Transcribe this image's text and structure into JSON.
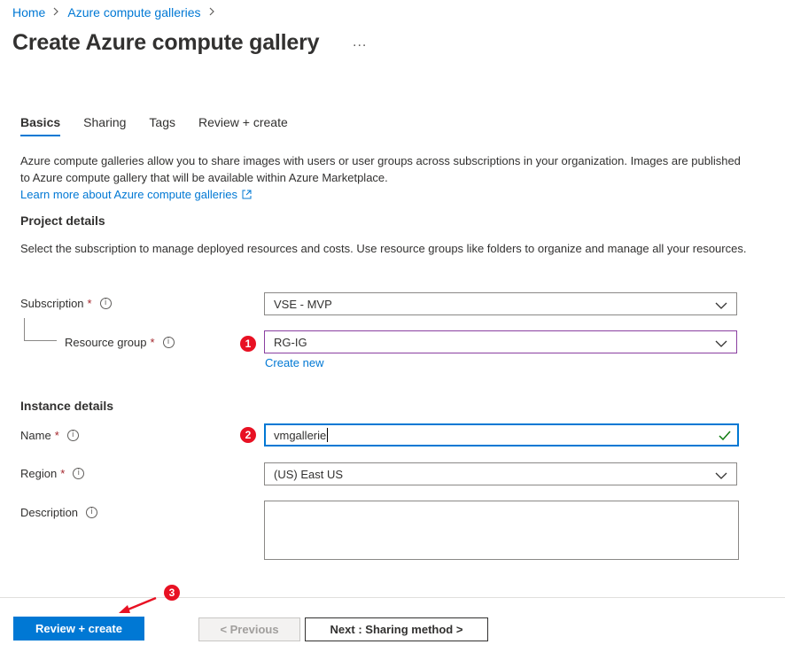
{
  "breadcrumb": {
    "home": "Home",
    "parent": "Azure compute galleries"
  },
  "page": {
    "title": "Create Azure compute gallery",
    "more": "..."
  },
  "tabs": [
    {
      "label": "Basics",
      "active": true
    },
    {
      "label": "Sharing",
      "active": false
    },
    {
      "label": "Tags",
      "active": false
    },
    {
      "label": "Review + create",
      "active": false
    }
  ],
  "intro": {
    "text": "Azure compute galleries allow you to share images with users or user groups across subscriptions in your organization. Images are published to Azure compute gallery that will be available within Azure Marketplace.",
    "link": "Learn more about Azure compute galleries"
  },
  "project": {
    "title": "Project details",
    "text": "Select the subscription to manage deployed resources and costs. Use resource groups like folders to organize and manage all your resources.",
    "subscription_label": "Subscription",
    "subscription_value": "VSE - MVP",
    "resource_group_label": "Resource group",
    "resource_group_value": "RG-IG",
    "create_new": "Create new"
  },
  "instance": {
    "title": "Instance details",
    "name_label": "Name",
    "name_value": "vmgallerie",
    "region_label": "Region",
    "region_value": "(US) East US",
    "description_label": "Description",
    "description_value": ""
  },
  "markers": {
    "one": "1",
    "two": "2",
    "three": "3"
  },
  "footer": {
    "review_create": "Review + create",
    "previous": "< Previous",
    "next": "Next : Sharing method >"
  },
  "colors": {
    "accent": "#0078d4",
    "required": "#a4262c",
    "marker": "#e81123",
    "valid": "#107c10"
  },
  "icons": {
    "info": "info-icon",
    "chevron": "chevron-down-icon",
    "external": "external-link-icon",
    "check": "checkmark-icon"
  }
}
